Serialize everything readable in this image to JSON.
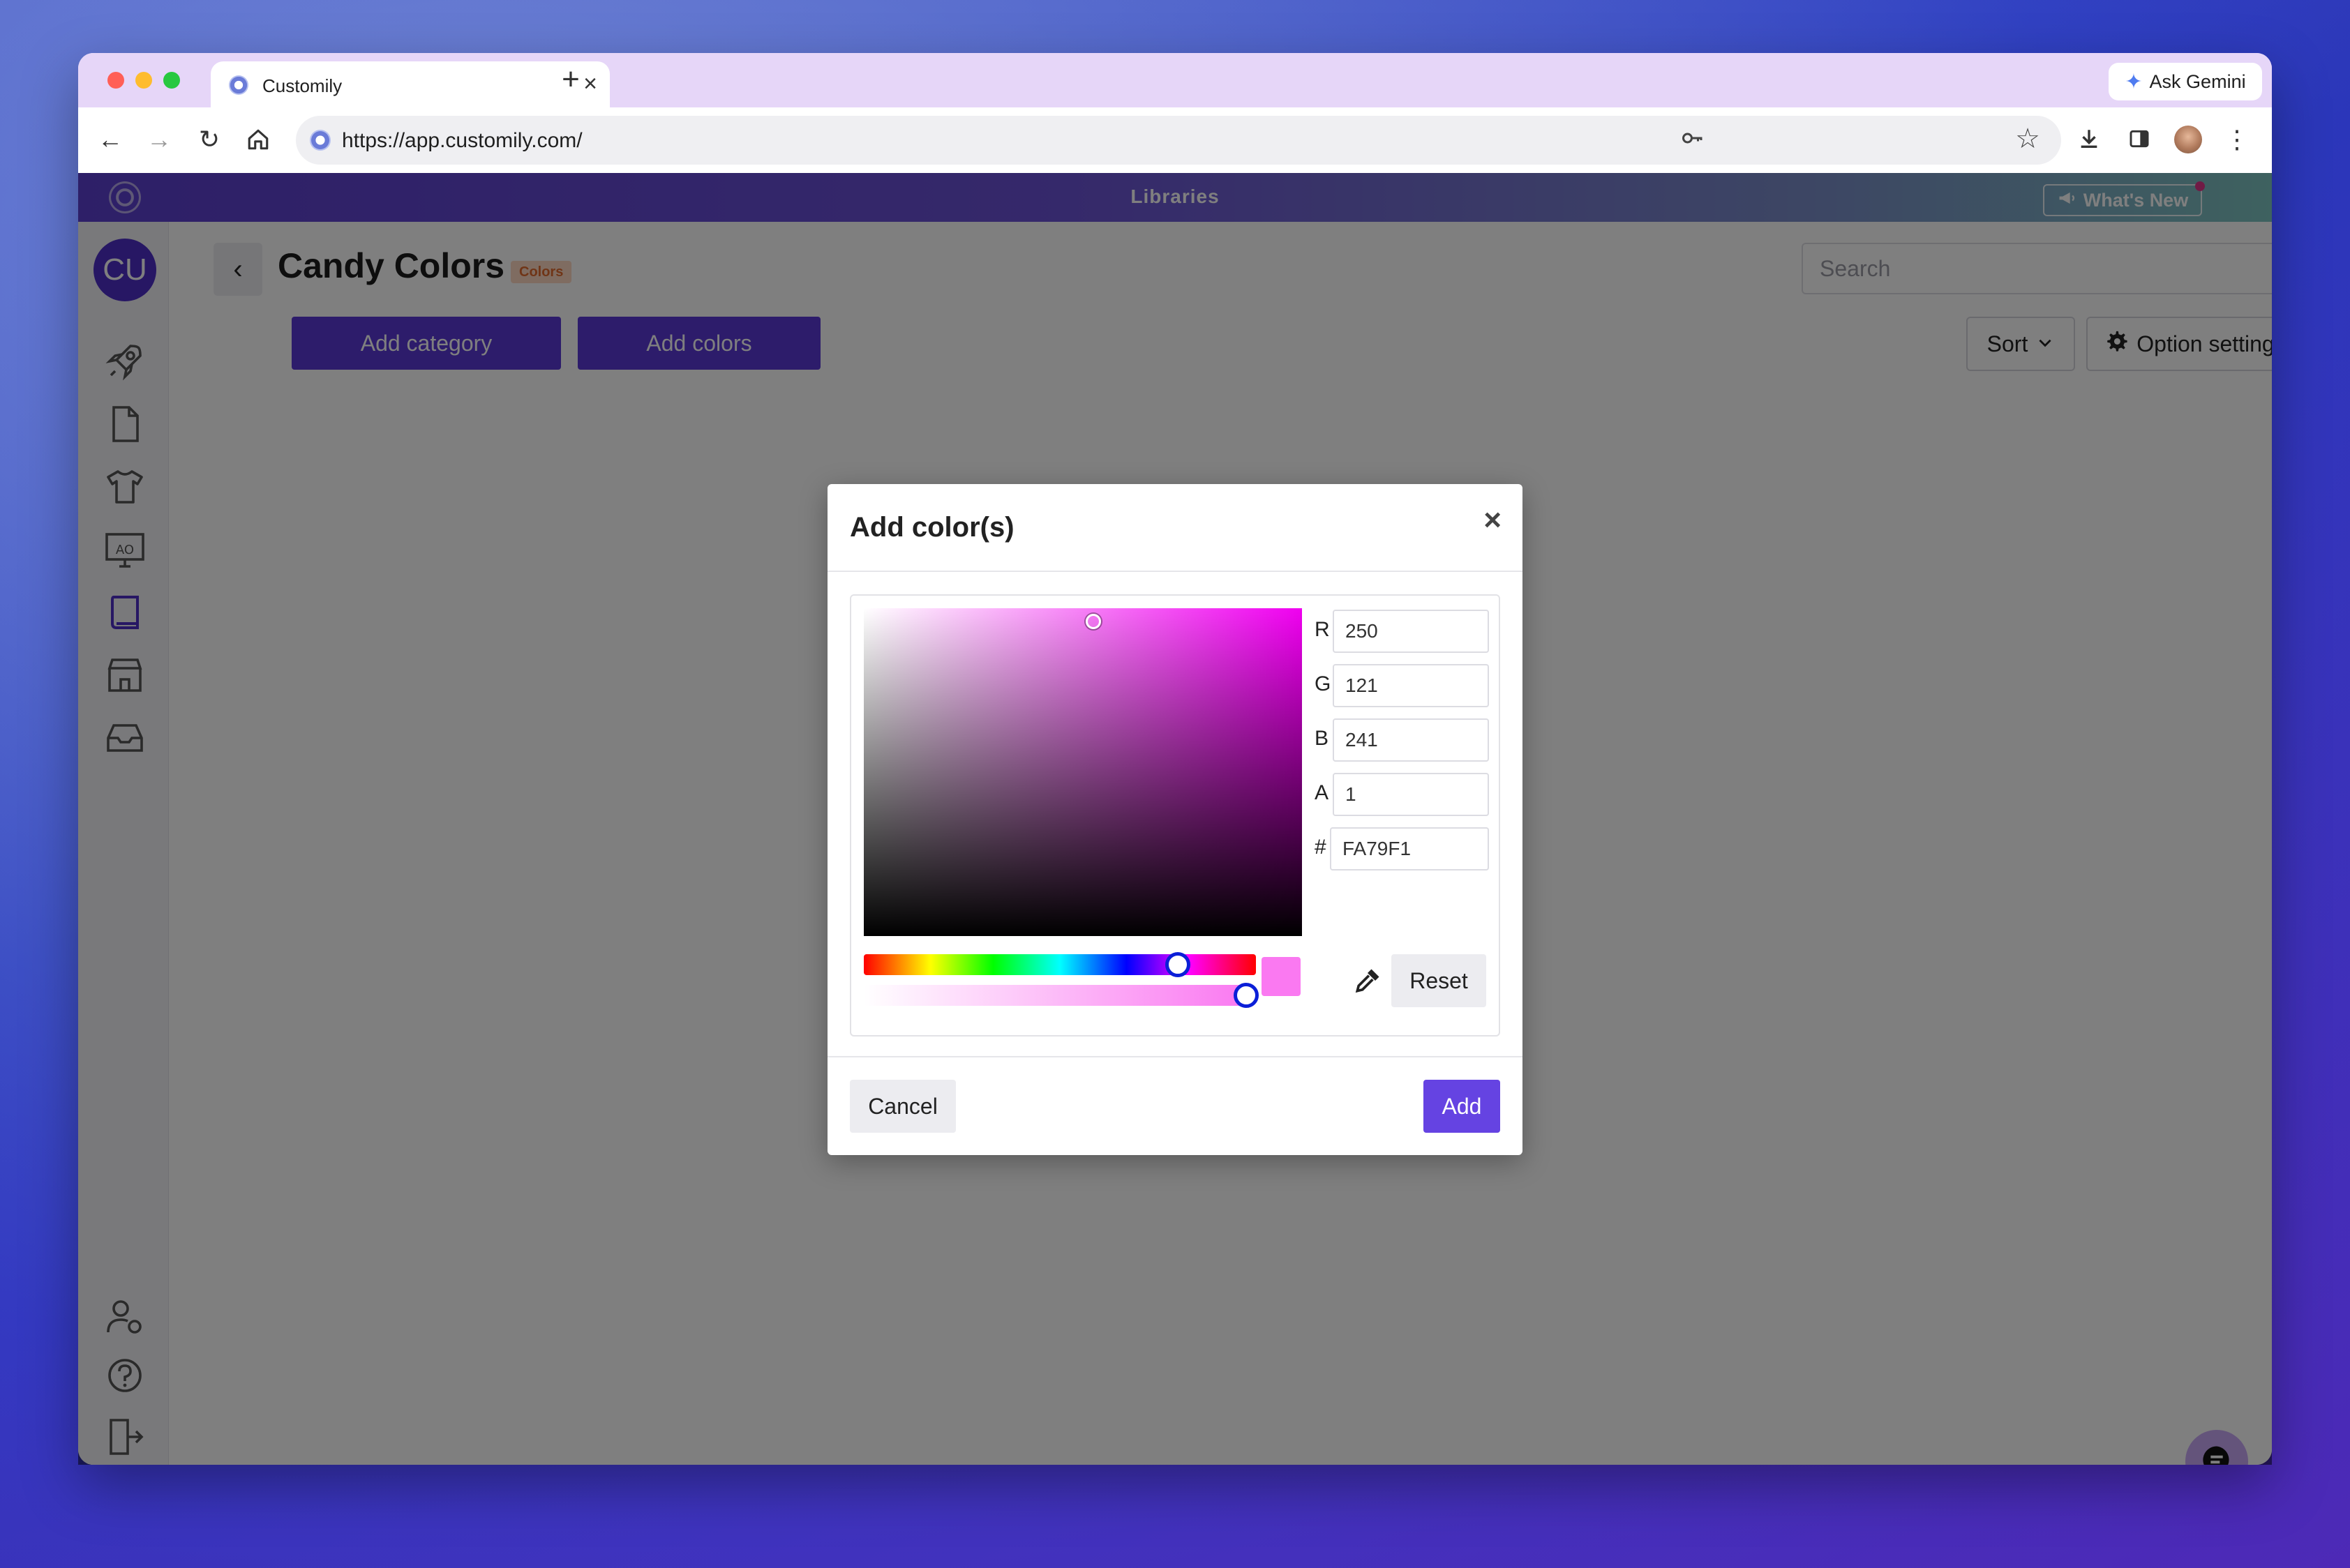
{
  "browser": {
    "tab_title": "Customily",
    "tab_close": "×",
    "new_tab": "+",
    "ask_gemini": "Ask Gemini",
    "url": "https://app.customily.com/",
    "icons": [
      "back-icon",
      "forward-icon",
      "reload-icon",
      "home-icon",
      "key-icon",
      "star-icon",
      "download-icon",
      "sidepanel-icon",
      "profile-avatar",
      "menu-icon"
    ]
  },
  "app": {
    "header_title": "Libraries",
    "whats_new": "What's New",
    "user_initials": "CU",
    "brand_color": "#5a38d6",
    "sidebar_icons": [
      "rocket-icon",
      "file-icon",
      "tshirt-icon",
      "monitor-icon",
      "book-icon",
      "store-icon",
      "inbox-icon",
      "user-settings-icon",
      "help-icon",
      "logout-icon"
    ]
  },
  "page": {
    "back": "‹",
    "title": "Candy Colors",
    "badge": "Colors",
    "add_category": "Add category",
    "add_colors": "Add colors",
    "search_placeholder": "Search",
    "sort": "Sort",
    "option_settings": "Option settings"
  },
  "modal": {
    "title": "Add color(s)",
    "close": "×",
    "fields": {
      "r_label": "R",
      "r_value": "250",
      "g_label": "G",
      "g_value": "121",
      "b_label": "B",
      "b_value": "241",
      "a_label": "A",
      "a_value": "1",
      "hex_label": "#",
      "hex_value": "FA79F1"
    },
    "selected_color": "#fa79f1",
    "hue_fraction": 0.83,
    "alpha_fraction": 1.0,
    "reset": "Reset",
    "cancel": "Cancel",
    "add": "Add"
  }
}
